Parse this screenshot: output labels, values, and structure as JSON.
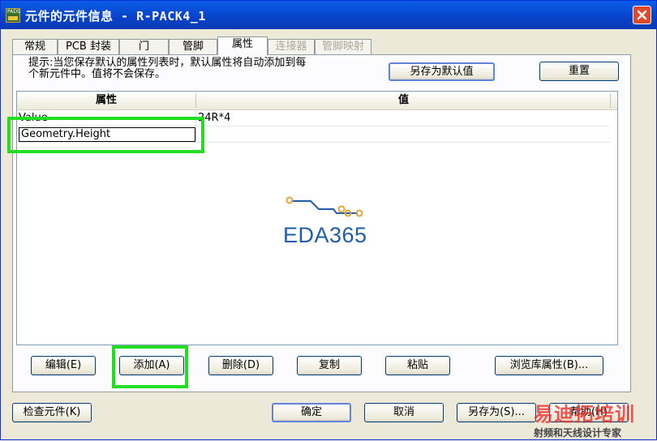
{
  "window": {
    "title": "元件的元件信息 - R-PACK4_1",
    "app_icon_text": "PADS"
  },
  "tabs": [
    {
      "label": "常规",
      "state": "normal"
    },
    {
      "label": "PCB 封装",
      "state": "normal"
    },
    {
      "label": "门",
      "state": "normal"
    },
    {
      "label": "管脚",
      "state": "normal"
    },
    {
      "label": "属性",
      "state": "active"
    },
    {
      "label": "连接器",
      "state": "disabled"
    },
    {
      "label": "管脚映射",
      "state": "disabled"
    }
  ],
  "hint": {
    "line1": "提示:当您保存默认的属性列表时，默认属性将自动添加到每",
    "line2": "个新元件中。值将不会保存。"
  },
  "top_buttons": {
    "save_default": "另存为默认值",
    "reset": "重置"
  },
  "table": {
    "headers": {
      "attribute": "属性",
      "value": "值"
    },
    "rows": [
      {
        "attribute": "Value",
        "value": "24R*4"
      },
      {
        "attribute": "Geometry.Height",
        "value": ""
      }
    ]
  },
  "logo_text": "EDA365",
  "table_buttons": {
    "edit": "编辑(E)",
    "add": "添加(A)",
    "delete": "删除(D)",
    "copy": "复制",
    "paste": "粘贴",
    "browse": "浏览库属性(B)..."
  },
  "bottom_buttons": {
    "check": "检查元件(K)",
    "ok": "确定",
    "cancel": "取消",
    "save_as": "另存为(S)...",
    "help": "帮助(H)"
  },
  "watermark": {
    "line1": "易迪拓培训",
    "line2": "射频和天线设计专家"
  },
  "colors": {
    "title_bar": "#0a4fd8",
    "highlight": "#22dd22",
    "logo_blue": "#1e5ea8",
    "logo_orange": "#e8a23a",
    "watermark_red": "#e8322e"
  }
}
